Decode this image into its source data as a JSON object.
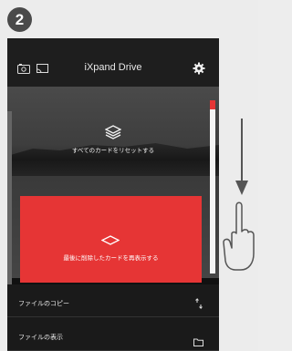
{
  "step": {
    "number": "2"
  },
  "app": {
    "title": "iXpand Drive"
  },
  "cards": {
    "reset_all": "すべてのカードをリセットする",
    "redisplay_last": "最後に削除したカードを再表示する"
  },
  "menu": {
    "items": [
      {
        "label": "ファイルのコピー",
        "icon": "sort-arrows-icon"
      },
      {
        "label": "ファイルの表示",
        "icon": "folder-icon"
      }
    ]
  },
  "colors": {
    "accent": "#e63535",
    "badge": "#4a4a4a",
    "background": "#ececec"
  },
  "icons": [
    "photo-icon",
    "cast-icon",
    "gear-icon",
    "stack-icon",
    "diamond-icon",
    "arrow-down-icon",
    "hand-icon"
  ]
}
